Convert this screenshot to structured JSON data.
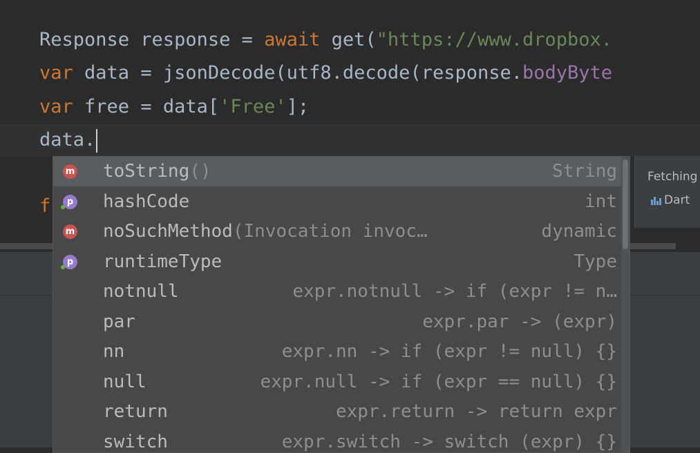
{
  "editor": {
    "line1": {
      "t1": "Response response = ",
      "kw": "await",
      "t2": " get(",
      "str": "\"https://www.dropbox."
    },
    "line2": {
      "kw": "var",
      "t1": " data = jsonDecode(utf8.decode(response.",
      "fld": "bodyByte"
    },
    "line3": {
      "kw": "var",
      "t1": " free = data[",
      "str": "'Free'",
      "t2": "];"
    },
    "line4": {
      "t1": "data."
    },
    "line5": {
      "t1": "f"
    }
  },
  "autocomplete": {
    "items": [
      {
        "icon": "method-icon",
        "badge": "m",
        "name": "toString",
        "params": "()",
        "type": "String",
        "selected": true
      },
      {
        "icon": "property-icon",
        "badge": "p",
        "name": "hashCode",
        "params": "",
        "type": "int"
      },
      {
        "icon": "method-icon",
        "badge": "m",
        "name": "noSuchMethod",
        "params": "(Invocation invoc…",
        "type": "dynamic"
      },
      {
        "icon": "property-icon",
        "badge": "p",
        "name": "runtimeType",
        "params": "",
        "type": "Type"
      },
      {
        "name": "notnull",
        "type": "expr.notnull -> if (expr != n…"
      },
      {
        "name": "par",
        "type": "expr.par -> (expr)"
      },
      {
        "name": "nn",
        "type": "expr.nn -> if (expr != null) {}"
      },
      {
        "name": "null",
        "type": "expr.null -> if (expr == null) {}"
      },
      {
        "name": "return",
        "type": "expr.return -> return expr"
      },
      {
        "name": "switch",
        "type": "expr.switch -> switch (expr) {}"
      }
    ]
  },
  "doc_popup": {
    "status": "Fetching",
    "lang": "Dart",
    "lang_icon": "dart-package-icon"
  },
  "colors": {
    "background": "#2b2b2b",
    "keyword": "#cc7832",
    "string": "#6a8759",
    "field": "#9876aa",
    "method_badge": "#c75450",
    "property_badge": "#9879cc"
  }
}
